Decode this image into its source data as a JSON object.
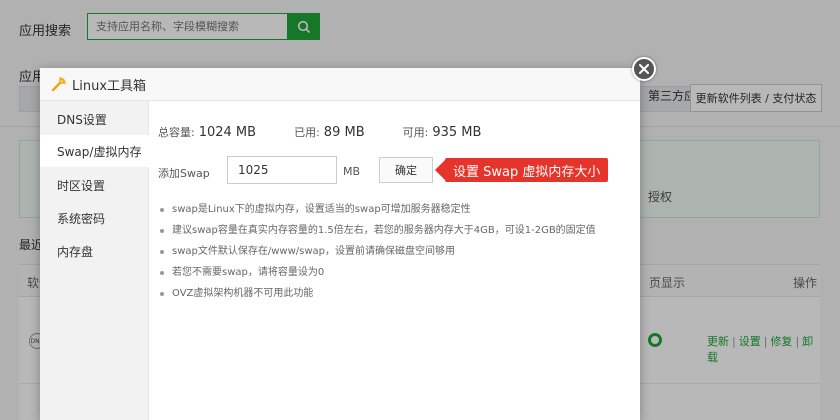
{
  "background": {
    "search_label": "应用搜索",
    "search_placeholder": "支持应用名称、字段模糊搜索",
    "category_label": "应用",
    "tab_third_party": "第三方应",
    "update_button": "更新软件列表 / 支付状态",
    "auth_text": "授权",
    "recent_label": "最近",
    "table_headers": {
      "software": "软件",
      "page_display": "页显示",
      "operations": "操作"
    },
    "row_icon_text": "DNS",
    "row_ops": [
      "更新",
      "设置",
      "修复",
      "卸载"
    ]
  },
  "dialog": {
    "title": "Linux工具箱",
    "sidebar": [
      {
        "label": "DNS设置",
        "active": false
      },
      {
        "label": "Swap/虚拟内存",
        "active": true
      },
      {
        "label": "时区设置",
        "active": false
      },
      {
        "label": "系统密码",
        "active": false
      },
      {
        "label": "内存盘",
        "active": false
      }
    ],
    "stats": {
      "total_key": "总容量:",
      "total_val": "1024 MB",
      "used_key": "已用:",
      "used_val": "89 MB",
      "avail_key": "可用:",
      "avail_val": "935 MB"
    },
    "swap": {
      "label": "添加Swap",
      "value": "1025",
      "unit": "MB",
      "confirm": "确定"
    },
    "callout": "设置 Swap 虚拟内存大小",
    "tips": [
      "swap是Linux下的虚拟内存，设置适当的swap可增加服务器稳定性",
      "建议swap容量在真实内存容量的1.5倍左右，若您的服务器内存大于4GB，可设1-2GB的固定值",
      "swap文件默认保存在/www/swap，设置前请确保磁盘空间够用",
      "若您不需要swap，请将容量设为0",
      "OVZ虚拟架构机器不可用此功能"
    ]
  },
  "colors": {
    "brand_green": "#20a53a",
    "callout_red": "#e5342c"
  },
  "icons": [
    "search-icon",
    "toolbox-logo-icon",
    "close-icon",
    "toggle-on-icon"
  ]
}
